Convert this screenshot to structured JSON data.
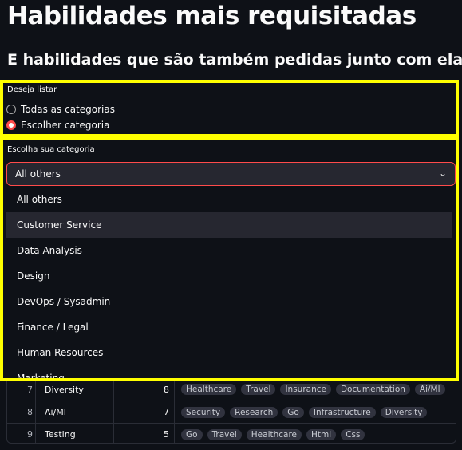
{
  "page": {
    "title": "Habilidades mais requisitadas",
    "subtitle": "E habilidades que são também pedidas junto com elas"
  },
  "radio": {
    "label": "Deseja listar",
    "options": [
      {
        "label": "Todas as categorias",
        "selected": false
      },
      {
        "label": "Escolher categoria",
        "selected": true
      }
    ]
  },
  "select": {
    "label": "Escolha sua categoria",
    "value": "All others",
    "options": [
      "All others",
      "Customer Service",
      "Data Analysis",
      "Design",
      "DevOps / Sysadmin",
      "Finance / Legal",
      "Human Resources",
      "Marketing"
    ],
    "hovered": "Customer Service"
  },
  "table": {
    "rows": [
      {
        "index": "7",
        "skill": "Diversity",
        "count": "8",
        "tags": [
          "Healthcare",
          "Travel",
          "Insurance",
          "Documentation",
          "Ai/Ml"
        ]
      },
      {
        "index": "8",
        "skill": "Ai/Ml",
        "count": "7",
        "tags": [
          "Security",
          "Research",
          "Go",
          "Infrastructure",
          "Diversity"
        ]
      },
      {
        "index": "9",
        "skill": "Testing",
        "count": "5",
        "tags": [
          "Go",
          "Travel",
          "Healthcare",
          "Html",
          "Css"
        ]
      }
    ]
  },
  "colors": {
    "background": "#0e1117",
    "accent": "#ff4b4b",
    "highlight_border": "#ffff00"
  },
  "icons": {
    "select_arrow": "chevron-down-icon"
  }
}
